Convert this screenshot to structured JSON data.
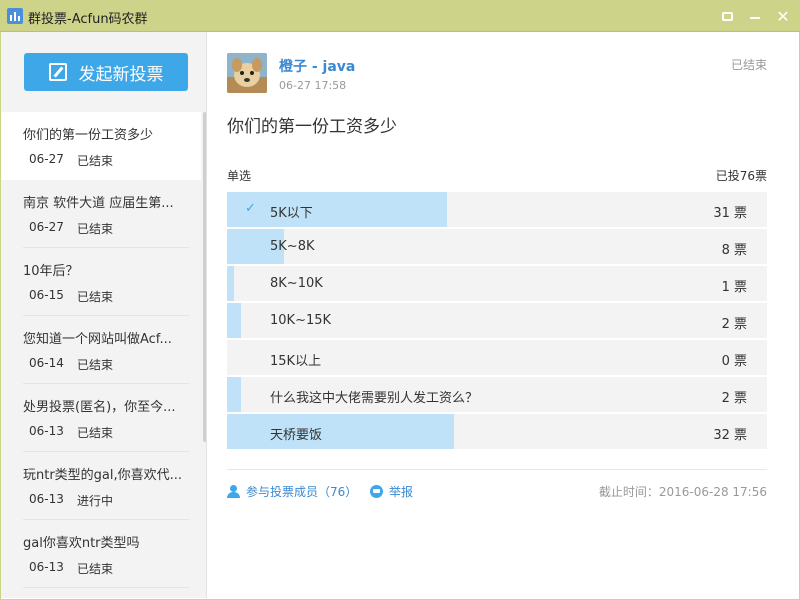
{
  "window": {
    "title": "群投票-Acfun码农群"
  },
  "sidebar": {
    "new_vote_label": "发起新投票",
    "items": [
      {
        "title": "你们的第一份工资多少",
        "date": "06-27",
        "status": "已结束"
      },
      {
        "title": "南京 软件大道 应届生第...",
        "date": "06-27",
        "status": "已结束"
      },
      {
        "title": "10年后？",
        "date": "06-15",
        "status": "已结束"
      },
      {
        "title": "您知道一个网站叫做Acf...",
        "date": "06-14",
        "status": "已结束"
      },
      {
        "title": "处男投票(匿名)，你至今...",
        "date": "06-13",
        "status": "已结束"
      },
      {
        "title": "玩ntr类型的gal,你喜欢代...",
        "date": "06-13",
        "status": "进行中"
      },
      {
        "title": "gal你喜欢ntr类型吗",
        "date": "06-13",
        "status": "已结束"
      }
    ]
  },
  "poll": {
    "author": "橙子 - java",
    "post_time": "06-27 17:58",
    "status": "已结束",
    "question": "你们的第一份工资多少",
    "type": "单选",
    "total": "已投76票",
    "options": [
      {
        "label": "5K以下",
        "count": "31 票",
        "votes": 31,
        "selected": true
      },
      {
        "label": "5K~8K",
        "count": "8 票",
        "votes": 8,
        "selected": false
      },
      {
        "label": "8K~10K",
        "count": "1 票",
        "votes": 1,
        "selected": false
      },
      {
        "label": "10K~15K",
        "count": "2 票",
        "votes": 2,
        "selected": false
      },
      {
        "label": "15K以上",
        "count": "0 票",
        "votes": 0,
        "selected": false
      },
      {
        "label": "什么我这中大佬需要别人发工资么？",
        "count": "2 票",
        "votes": 2,
        "selected": false
      },
      {
        "label": "天桥要饭",
        "count": "32 票",
        "votes": 32,
        "selected": false
      }
    ],
    "max_votes": 76
  },
  "footer": {
    "members_label": "参与投票成员（76）",
    "report_label": "举报",
    "deadline": "截止时间：2016-06-28 17:56"
  },
  "colors": {
    "titlebar": "#cdd389",
    "accent": "#3da7e8",
    "bar_fill": "#bfe2f8",
    "link": "#3a89d1"
  },
  "icons": [
    "chart-icon",
    "message-icon",
    "minimize-icon",
    "close-icon",
    "edit-icon",
    "check-icon",
    "person-icon",
    "report-icon"
  ]
}
